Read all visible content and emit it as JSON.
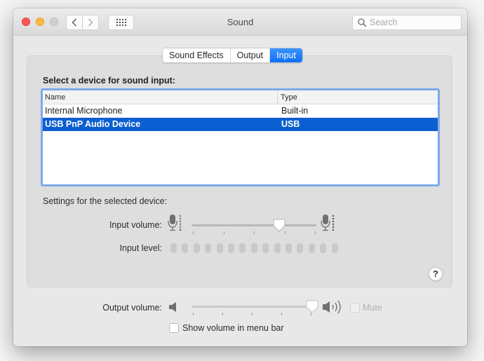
{
  "window": {
    "title": "Sound",
    "search_placeholder": "Search"
  },
  "tabs": [
    {
      "label": "Sound Effects",
      "active": false
    },
    {
      "label": "Output",
      "active": false
    },
    {
      "label": "Input",
      "active": true
    }
  ],
  "input_panel": {
    "device_section_label": "Select a device for sound input:",
    "columns": {
      "name": "Name",
      "type": "Type"
    },
    "devices": [
      {
        "name": "Internal Microphone",
        "type": "Built-in",
        "selected": false
      },
      {
        "name": "USB PnP Audio Device",
        "type": "USB",
        "selected": true
      }
    ],
    "settings_label": "Settings for the selected device:",
    "input_volume_label": "Input volume:",
    "input_volume_fraction": 0.7,
    "input_level_label": "Input level:",
    "input_level_segments": 15,
    "input_level_active": 0
  },
  "output": {
    "output_volume_label": "Output volume:",
    "output_volume_fraction": 1.0,
    "mute_label": "Mute",
    "mute_checked": false,
    "mute_enabled": false,
    "show_volume_label": "Show volume in menu bar",
    "show_volume_checked": false
  },
  "help_label": "?",
  "colors": {
    "accent": "#0d6ff7",
    "selection": "#0c5fd0",
    "focus_ring": "#7ea8ea",
    "close": "#fc5753",
    "minimize": "#fdbc40"
  }
}
